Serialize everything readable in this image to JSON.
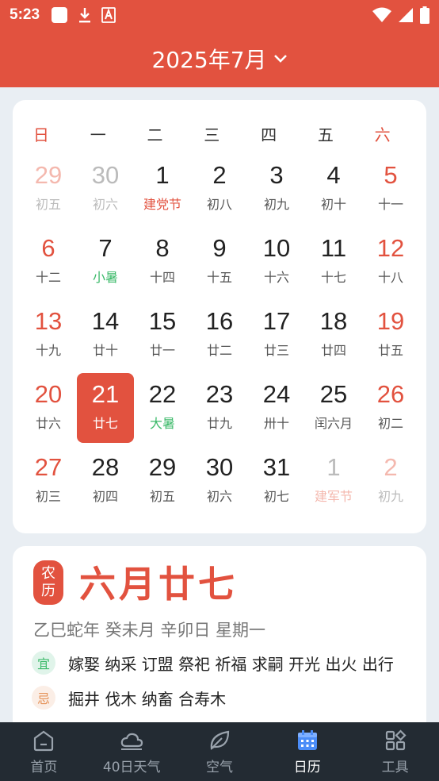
{
  "status": {
    "time": "5:23"
  },
  "header": {
    "month_title": "2025年7月"
  },
  "weekdays": [
    "日",
    "一",
    "二",
    "三",
    "四",
    "五",
    "六"
  ],
  "weeks": [
    [
      {
        "d": "29",
        "l": "初五",
        "other": true
      },
      {
        "d": "30",
        "l": "初六",
        "other": true
      },
      {
        "d": "1",
        "l": "建党节",
        "lc": "red"
      },
      {
        "d": "2",
        "l": "初八"
      },
      {
        "d": "3",
        "l": "初九"
      },
      {
        "d": "4",
        "l": "初十"
      },
      {
        "d": "5",
        "l": "十一"
      }
    ],
    [
      {
        "d": "6",
        "l": "十二"
      },
      {
        "d": "7",
        "l": "小暑",
        "lc": "green"
      },
      {
        "d": "8",
        "l": "十四"
      },
      {
        "d": "9",
        "l": "十五"
      },
      {
        "d": "10",
        "l": "十六"
      },
      {
        "d": "11",
        "l": "十七"
      },
      {
        "d": "12",
        "l": "十八"
      }
    ],
    [
      {
        "d": "13",
        "l": "十九"
      },
      {
        "d": "14",
        "l": "廿十"
      },
      {
        "d": "15",
        "l": "廿一"
      },
      {
        "d": "16",
        "l": "廿二"
      },
      {
        "d": "17",
        "l": "廿三"
      },
      {
        "d": "18",
        "l": "廿四"
      },
      {
        "d": "19",
        "l": "廿五"
      }
    ],
    [
      {
        "d": "20",
        "l": "廿六"
      },
      {
        "d": "21",
        "l": "廿七",
        "today": true
      },
      {
        "d": "22",
        "l": "大暑",
        "lc": "green"
      },
      {
        "d": "23",
        "l": "廿九"
      },
      {
        "d": "24",
        "l": "卅十"
      },
      {
        "d": "25",
        "l": "闰六月"
      },
      {
        "d": "26",
        "l": "初二"
      }
    ],
    [
      {
        "d": "27",
        "l": "初三"
      },
      {
        "d": "28",
        "l": "初四"
      },
      {
        "d": "29",
        "l": "初五"
      },
      {
        "d": "30",
        "l": "初六"
      },
      {
        "d": "31",
        "l": "初七"
      },
      {
        "d": "1",
        "l": "建军节",
        "lc": "red",
        "other": true
      },
      {
        "d": "2",
        "l": "初九",
        "other": true
      }
    ]
  ],
  "lunar": {
    "badge_top": "农",
    "badge_bottom": "历",
    "date": "六月廿七",
    "ganzhi": "乙巳蛇年 癸未月 辛卯日 星期一",
    "yi_label": "宜",
    "yi_text": "嫁娶 纳采 订盟 祭祀 祈福 求嗣 开光 出火 出行",
    "ji_label": "忌",
    "ji_text": "掘井 伐木 纳畜 合寿木"
  },
  "nav": [
    {
      "label": "首页",
      "icon": "home-icon"
    },
    {
      "label": "40日天气",
      "icon": "cloud-icon"
    },
    {
      "label": "空气",
      "icon": "leaf-icon"
    },
    {
      "label": "日历",
      "icon": "calendar-icon",
      "active": true
    },
    {
      "label": "工具",
      "icon": "grid-icon"
    }
  ],
  "colors": {
    "accent": "#e2523f",
    "green": "#3cba6a",
    "nav_bg": "#232b33"
  }
}
